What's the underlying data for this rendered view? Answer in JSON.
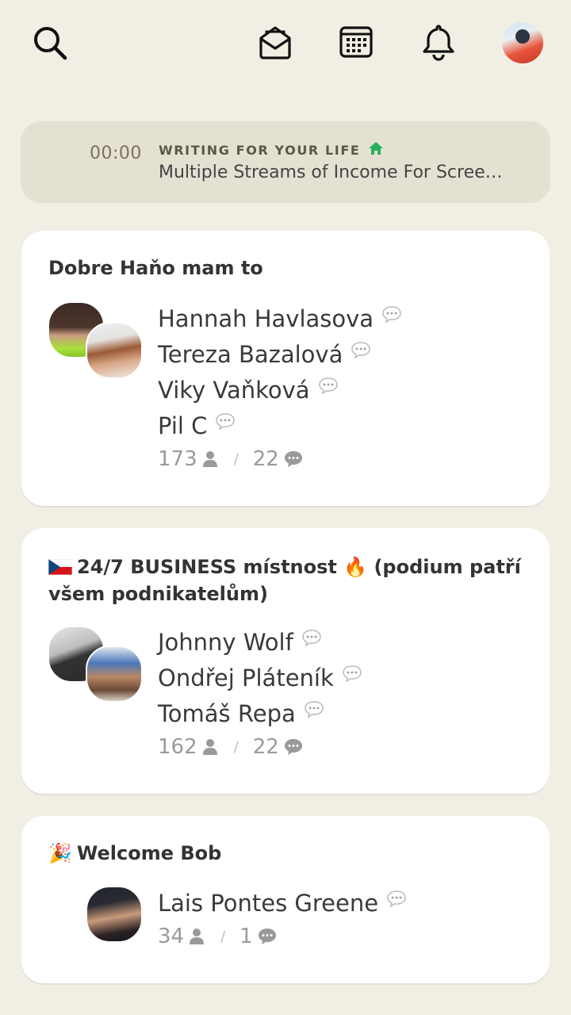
{
  "header": {
    "icons": [
      "search-icon",
      "invite-envelope-icon",
      "calendar-icon",
      "bell-icon"
    ],
    "avatar": "profile-avatar"
  },
  "now_playing": {
    "time": "00:00",
    "club": "WRITING FOR YOUR LIFE",
    "club_icon": "house-icon",
    "title": "Multiple Streams of Income For Scree…",
    "accent": "#27ae60"
  },
  "rooms": [
    {
      "title": "Dobre Haňo mam to",
      "speakers": [
        "Hannah Havlasova",
        "Tereza Bazalová",
        "Viky Vaňková",
        "Pil C"
      ],
      "listeners": "173",
      "speaker_count": "22"
    },
    {
      "title_flag": "czech-flag",
      "title": "24/7 BUSINESS místnost 🔥 (podium patří všem podnikatelům)",
      "speakers": [
        "Johnny Wolf",
        "Ondřej Pláteník",
        "Tomáš Repa"
      ],
      "listeners": "162",
      "speaker_count": "22"
    },
    {
      "title_emoji": "🎉",
      "title": "Welcome Bob",
      "speakers": [
        "Lais Pontes Greene"
      ],
      "listeners": "34",
      "speaker_count": "1"
    }
  ]
}
